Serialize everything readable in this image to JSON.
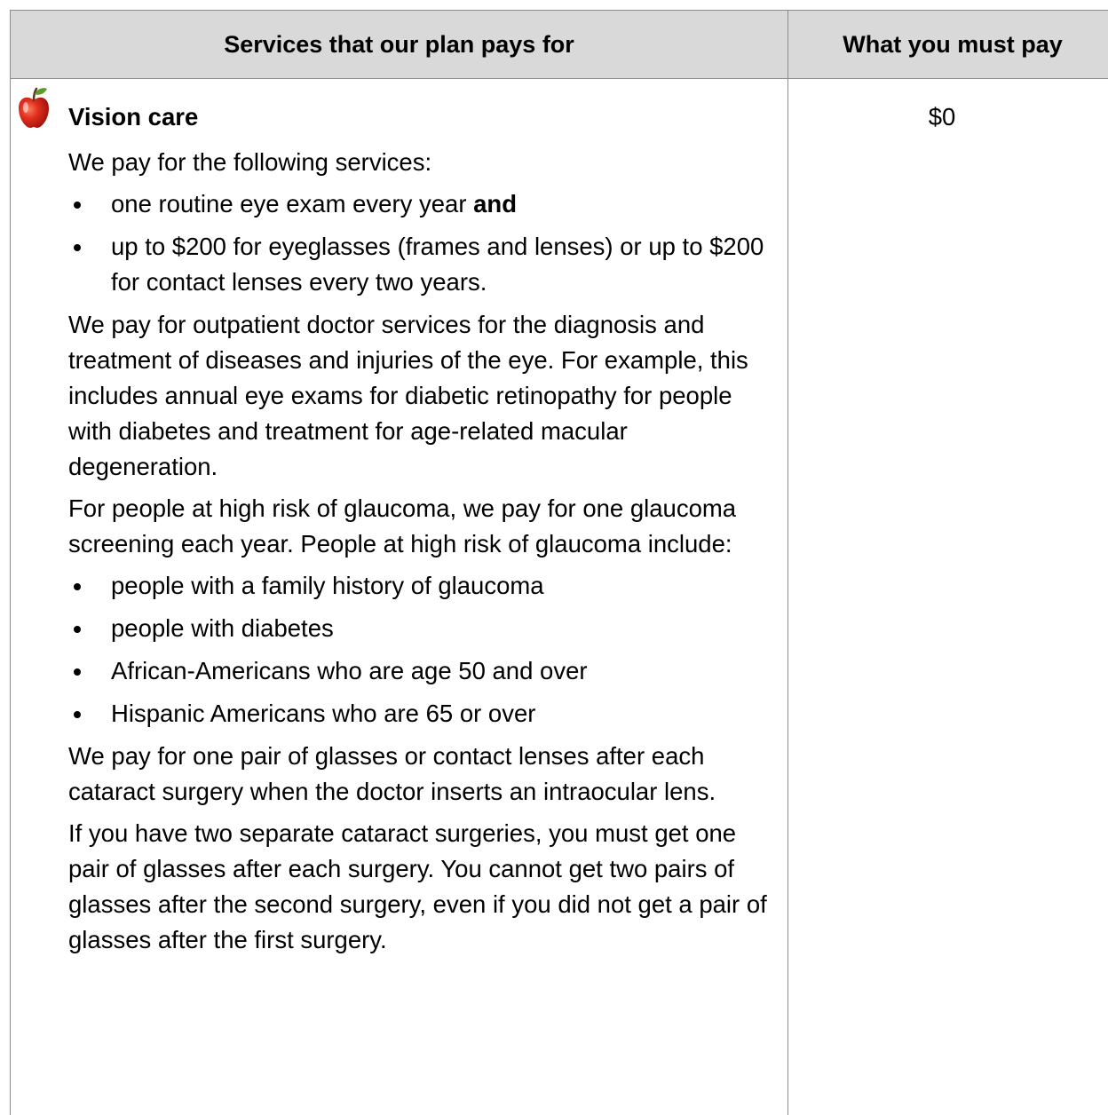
{
  "header": {
    "col_services": "Services that our plan pays for",
    "col_pay": "What you must pay"
  },
  "row": {
    "icon": "apple-icon",
    "title": "Vision care",
    "intro": "We pay for the following services:",
    "bullets1": [
      {
        "text": "one routine eye exam every year ",
        "bold": "and"
      },
      {
        "text": "up to $200 for eyeglasses (frames and lenses) or up to $200 for contact lenses every two years."
      }
    ],
    "para_outpatient": "We pay for outpatient doctor services for the diagnosis and treatment of diseases and injuries of the eye. For example, this includes annual eye exams for diabetic retinopathy for people with diabetes and treatment for age-related macular degeneration.",
    "para_glaucoma": "For people at high risk of glaucoma, we pay for one glaucoma screening each year. People at high risk of glaucoma include:",
    "bullets2": [
      "people with a family history of glaucoma",
      "people with diabetes",
      "African-Americans who are age 50 and over",
      "Hispanic Americans who are 65 or over"
    ],
    "para_cataract": "We pay for one pair of glasses or contact lenses after each cataract surgery when the doctor inserts an intraocular lens.",
    "para_two_surgeries": "If you have two separate cataract surgeries, you must get one pair of glasses after each surgery. You cannot get two pairs of glasses after the second surgery, even if you did not get a pair of glasses after the first surgery.",
    "cost": "$0"
  },
  "colors": {
    "header_bg": "#d9d9d9",
    "border": "#8c8c8c",
    "apple_red": "#d9261c"
  }
}
